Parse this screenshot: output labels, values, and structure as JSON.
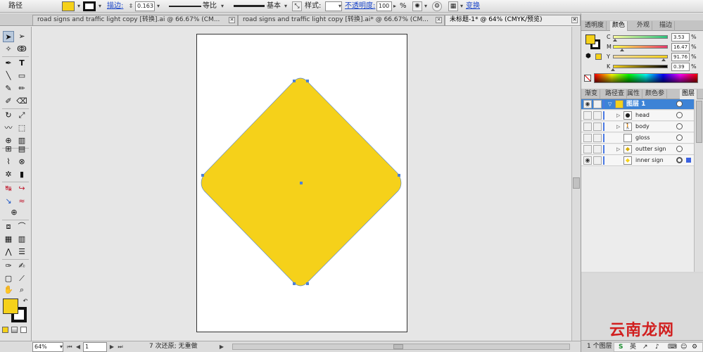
{
  "control_bar": {
    "object_type": "路径",
    "stroke_label": "描边:",
    "stroke_weight": "0.163",
    "profile_label": "等比",
    "brush_label": "基本",
    "style_label": "样式:",
    "opacity_label": "不透明度:",
    "opacity_value": "100",
    "opacity_unit": "%",
    "transform_label": "变换",
    "fill_color": "#f5d11a"
  },
  "tabs": [
    {
      "label": "road signs and traffic light copy [转换].ai @ 66.67% (CM..."
    },
    {
      "label": "road signs and traffic light copy [转换].ai* @ 66.67% (CM..."
    },
    {
      "label": "未标题-1* @ 64% (CMYK/预览)"
    }
  ],
  "tab_close": "✕",
  "status": {
    "zoom": "64%",
    "artboard": "1",
    "message": "7 次还原; 无重做"
  },
  "color_panel": {
    "tabs": [
      "透明度",
      "颜色",
      "外观",
      "描边"
    ],
    "c": "3.53",
    "m": "16.47",
    "y": "91.76",
    "k": "0.39",
    "c_value": 3.53,
    "m_value": 16.47,
    "y_value": 91.76,
    "k_value": 0.39,
    "labels": {
      "c": "C",
      "m": "M",
      "y": "Y",
      "k": "K"
    },
    "unit": "%"
  },
  "layers_panel": {
    "tabs": [
      "渐变",
      "路径查",
      "属性",
      "颜色参",
      "图层"
    ],
    "rows": [
      {
        "name": "图层 1"
      },
      {
        "name": "head"
      },
      {
        "name": "body"
      },
      {
        "name": "gloss"
      },
      {
        "name": "outter sign"
      },
      {
        "name": "inner sign"
      }
    ],
    "count": "1 个图层"
  },
  "watermark": "云南龙网",
  "ime": "英"
}
